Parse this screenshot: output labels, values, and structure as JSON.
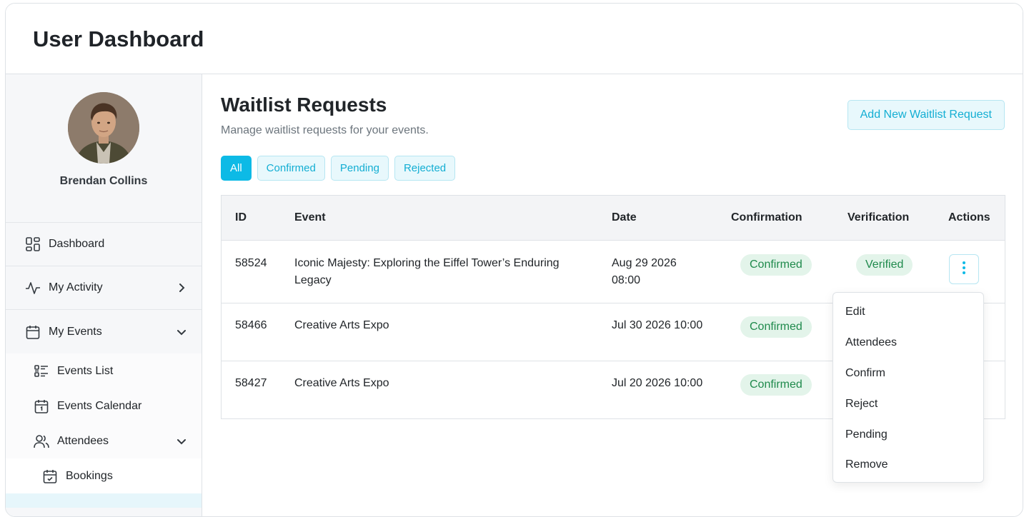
{
  "app": {
    "title": "User Dashboard"
  },
  "sidebar": {
    "profile_name": "Brendan Collins",
    "items": [
      {
        "label": "Dashboard",
        "icon": "dashboard-icon"
      },
      {
        "label": "My Activity",
        "icon": "activity-icon"
      },
      {
        "label": "My Events",
        "icon": "calendar-icon"
      }
    ],
    "events_sub": [
      {
        "label": "Events List",
        "icon": "list-icon"
      },
      {
        "label": "Events Calendar",
        "icon": "calendar-icon"
      },
      {
        "label": "Attendees",
        "icon": "users-icon"
      }
    ],
    "attendees_sub": [
      {
        "label": "Bookings",
        "icon": "calendar-check-icon"
      }
    ]
  },
  "main": {
    "title": "Waitlist Requests",
    "subtitle": "Manage waitlist requests for your events.",
    "add_button": "Add New Waitlist Request",
    "filters": [
      "All",
      "Confirmed",
      "Pending",
      "Rejected"
    ],
    "active_filter": "All",
    "table": {
      "headers": [
        "ID",
        "Event",
        "Date",
        "Confirmation",
        "Verification",
        "Actions"
      ],
      "rows": [
        {
          "id": "58524",
          "event_line1": "Iconic Majesty: Exploring the Eiffel Tower’s Enduring",
          "event_line2": "Legacy",
          "date_line1": "Aug 29 2026",
          "date_line2": "08:00",
          "confirmation": "Confirmed",
          "verification": "Verified"
        },
        {
          "id": "58466",
          "event_line1": "Creative Arts Expo",
          "event_line2": "",
          "date_line1": "Jul 30 2026 10:00",
          "date_line2": "",
          "confirmation": "Confirmed",
          "verification": ""
        },
        {
          "id": "58427",
          "event_line1": "Creative Arts Expo",
          "event_line2": "",
          "date_line1": "Jul 20 2026 10:00",
          "date_line2": "",
          "confirmation": "Confirmed",
          "verification": ""
        }
      ]
    },
    "actions_menu": [
      "Edit",
      "Attendees",
      "Confirm",
      "Reject",
      "Pending",
      "Remove"
    ]
  },
  "colors": {
    "accent": "#0dbae6",
    "accent_light": "#e8f8fc",
    "success_bg": "#e3f4ea",
    "success_text": "#1f8a4c"
  }
}
